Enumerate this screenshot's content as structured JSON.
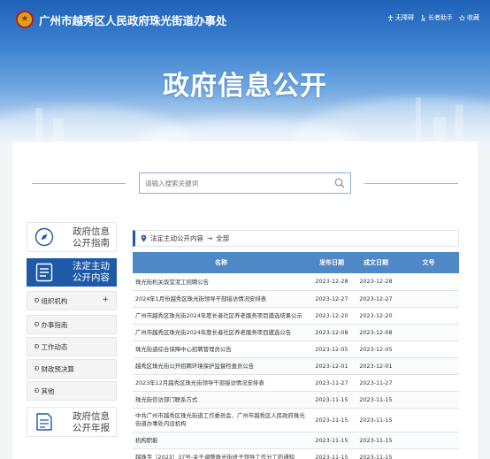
{
  "header": {
    "site_title": "广州市越秀区人民政府珠光街道办事处",
    "links": [
      {
        "icon": "accessibility-icon",
        "label": "无障碍"
      },
      {
        "icon": "elder-icon",
        "label": "长者助手"
      },
      {
        "icon": "star-icon",
        "label": "收藏"
      }
    ]
  },
  "banner": {
    "title": "政府信息公开"
  },
  "search": {
    "placeholder": "请输入搜索关键词"
  },
  "sidebar": {
    "guide_label": "政府信息公开指南",
    "active_label": "法定主动公开内容",
    "items": [
      {
        "label": "组织机构",
        "expandable": true
      },
      {
        "label": "办事指南",
        "expandable": false
      },
      {
        "label": "工作动态",
        "expandable": false
      },
      {
        "label": "财政预决算",
        "expandable": false
      },
      {
        "label": "其他",
        "expandable": false
      }
    ],
    "expand_symbol": "+",
    "annual_label": "政府信息公开年报"
  },
  "breadcrumb": {
    "root": "法定主动公开内容",
    "separator": "→",
    "current": "全部"
  },
  "table": {
    "headers": [
      "名称",
      "发布日期",
      "成文日期",
      "文号"
    ],
    "rows": [
      {
        "title": "珠光街机关饭堂泥工招聘公告",
        "pub": "2023-12-28",
        "made": "2023-12-28",
        "no": ""
      },
      {
        "title": "2024年1月份越秀区珠光街领导干部接访情况安排表",
        "pub": "2023-12-27",
        "made": "2023-12-27",
        "no": ""
      },
      {
        "title": "广州市越秀区珠光街2024年度长者社区养老服务项目遴选结果公示",
        "pub": "2023-12-20",
        "made": "2023-12-20",
        "no": ""
      },
      {
        "title": "广州市越秀区珠光街2024年度长者社区养老服务项目遴选公告",
        "pub": "2023-12-08",
        "made": "2023-12-08",
        "no": ""
      },
      {
        "title": "珠光街道综合保障中心招聘管理员公告",
        "pub": "2023-12-05",
        "made": "2023-12-05",
        "no": ""
      },
      {
        "title": "越秀区珠光街公开招聘环境保护监督检查员公告",
        "pub": "2023-12-01",
        "made": "2023-12-01",
        "no": ""
      },
      {
        "title": "2023年12月越秀区珠光街领导干部接访情况安排表",
        "pub": "2023-11-27",
        "made": "2023-11-27",
        "no": ""
      },
      {
        "title": "珠光街信访部门联系方式",
        "pub": "2023-11-15",
        "made": "2023-11-15",
        "no": ""
      },
      {
        "title": "中共广州市越秀区珠光街道工作委员会、广州市越秀区人民政府珠光街道办事处内设机构",
        "pub": "2023-11-15",
        "made": "2023-11-15",
        "no": ""
      },
      {
        "title": "机构职能",
        "pub": "2023-11-15",
        "made": "2023-11-15",
        "no": ""
      },
      {
        "title": "越珠字〔2023〕37号-关于调整珠光街班子领导工作分工的通知",
        "pub": "2023-11-15",
        "made": "2023-11-15",
        "no": ""
      }
    ]
  },
  "colors": {
    "primary": "#1e5aa8",
    "table_header": "#4f88c6"
  }
}
